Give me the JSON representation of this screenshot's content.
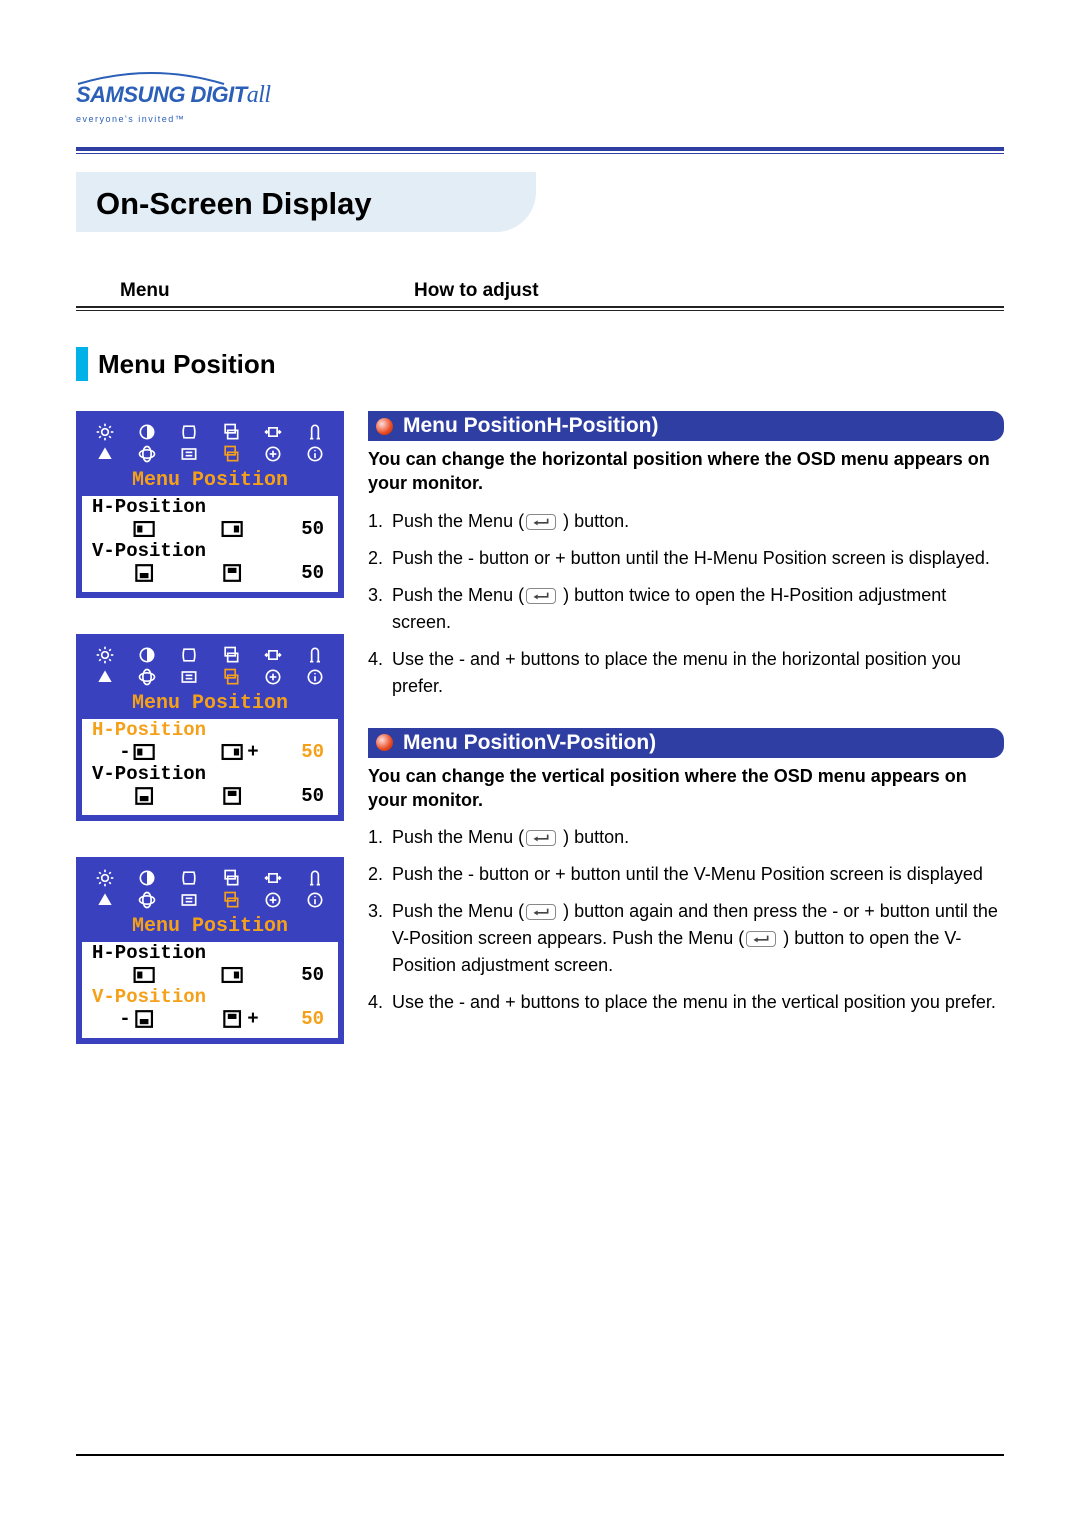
{
  "logo": {
    "brand": "SAMSUNG DIGIT",
    "brand_suffix": "all",
    "tagline": "everyone's invited™"
  },
  "page_title": "On-Screen Display",
  "tabs": {
    "menu": "Menu",
    "adjust": "How to adjust"
  },
  "section_title": "Menu Position",
  "osd": {
    "title": "Menu Position",
    "h_label": "H-Position",
    "v_label": "V-Position",
    "h_value": "50",
    "v_value": "50",
    "minus": "-",
    "plus": "+"
  },
  "h_section": {
    "heading": "Menu PositionH-Position)",
    "lead": "You can change the horizontal position where the OSD menu appears on your monitor.",
    "steps": [
      {
        "pre": "Push the Menu (",
        "post": " ) button."
      },
      {
        "text": "Push the - button or + button until the H-Menu Position screen is displayed."
      },
      {
        "pre": "Push the Menu (",
        "post": " ) button twice to open the H-Position adjustment screen."
      },
      {
        "text": "Use the - and + buttons to place the menu in the horizontal position you prefer."
      }
    ]
  },
  "v_section": {
    "heading": "Menu PositionV-Position)",
    "lead": "You can change the vertical position where the OSD menu appears on your monitor.",
    "steps": [
      {
        "pre": "Push the Menu (",
        "post": " ) button."
      },
      {
        "text": "Push the - button or + button until the V-Menu Position screen is displayed"
      },
      {
        "pre": "Push the Menu (",
        "mid": " ) button again and then press the - or + button until the V-Position screen appears. Push the Menu (",
        "post": " ) button to open the V-Position adjustment screen."
      },
      {
        "text": "Use the - and + buttons to place the menu in the vertical position you prefer."
      }
    ]
  }
}
